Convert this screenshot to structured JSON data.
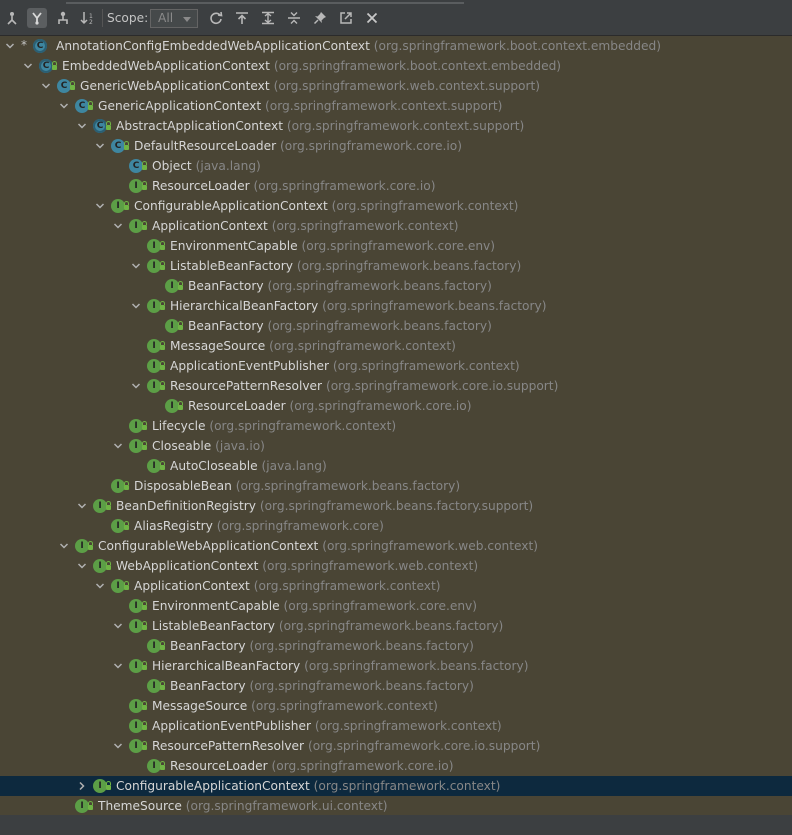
{
  "toolbar": {
    "scope_label": "Scope:",
    "scope_value": "All",
    "buttons": [
      {
        "name": "supertypes-hierarchy-button",
        "icon": "supertypes-icon"
      },
      {
        "name": "class-hierarchy-button",
        "icon": "hierarchy-icon",
        "active": true
      },
      {
        "name": "subtypes-hierarchy-button",
        "icon": "subtypes-icon"
      },
      {
        "name": "sort-alphabetically-button",
        "icon": "sort-alpha-icon"
      },
      {
        "name": "refresh-button",
        "icon": "refresh-icon"
      },
      {
        "name": "base-on-this-class-button",
        "icon": "base-class-icon"
      },
      {
        "name": "expand-all-button",
        "icon": "expand-all-icon"
      },
      {
        "name": "collapse-all-button",
        "icon": "collapse-all-icon"
      },
      {
        "name": "pin-tab-button",
        "icon": "pin-icon"
      },
      {
        "name": "export-button",
        "icon": "export-icon"
      },
      {
        "name": "close-button",
        "icon": "close-icon"
      }
    ]
  },
  "colors": {
    "background": "#4a4535",
    "toolbar": "#3c3f41",
    "selected_row": "#0d293e",
    "class_icon": "#3e86a0",
    "interface_icon": "#5c9e46",
    "package_text": "#878787",
    "name_text": "#d6d6d6"
  },
  "tree": [
    {
      "depth": 0,
      "arrow": "expanded",
      "star": true,
      "icon": "abstract-class",
      "lock": false,
      "name": "AnnotationConfigEmbeddedWebApplicationContext",
      "pkg": "(org.springframework.boot.context.embedded)"
    },
    {
      "depth": 1,
      "arrow": "expanded",
      "icon": "abstract-class",
      "lock": true,
      "name": "EmbeddedWebApplicationContext",
      "pkg": "(org.springframework.boot.context.embedded)"
    },
    {
      "depth": 2,
      "arrow": "expanded",
      "icon": "class",
      "lock": true,
      "name": "GenericWebApplicationContext",
      "pkg": "(org.springframework.web.context.support)"
    },
    {
      "depth": 3,
      "arrow": "expanded",
      "icon": "class",
      "lock": true,
      "name": "GenericApplicationContext",
      "pkg": "(org.springframework.context.support)"
    },
    {
      "depth": 4,
      "arrow": "expanded",
      "icon": "abstract-class",
      "lock": true,
      "name": "AbstractApplicationContext",
      "pkg": "(org.springframework.context.support)"
    },
    {
      "depth": 5,
      "arrow": "expanded",
      "icon": "class",
      "lock": true,
      "name": "DefaultResourceLoader",
      "pkg": "(org.springframework.core.io)"
    },
    {
      "depth": 6,
      "arrow": "none",
      "icon": "class",
      "lock": true,
      "name": "Object",
      "pkg": "(java.lang)"
    },
    {
      "depth": 6,
      "arrow": "none",
      "icon": "interface",
      "lock": true,
      "name": "ResourceLoader",
      "pkg": "(org.springframework.core.io)"
    },
    {
      "depth": 5,
      "arrow": "expanded",
      "icon": "interface",
      "lock": true,
      "name": "ConfigurableApplicationContext",
      "pkg": "(org.springframework.context)"
    },
    {
      "depth": 6,
      "arrow": "expanded",
      "icon": "interface",
      "lock": true,
      "name": "ApplicationContext",
      "pkg": "(org.springframework.context)"
    },
    {
      "depth": 7,
      "arrow": "none",
      "icon": "interface",
      "lock": true,
      "name": "EnvironmentCapable",
      "pkg": "(org.springframework.core.env)"
    },
    {
      "depth": 7,
      "arrow": "expanded",
      "icon": "interface",
      "lock": true,
      "name": "ListableBeanFactory",
      "pkg": "(org.springframework.beans.factory)"
    },
    {
      "depth": 8,
      "arrow": "none",
      "icon": "interface",
      "lock": true,
      "name": "BeanFactory",
      "pkg": "(org.springframework.beans.factory)"
    },
    {
      "depth": 7,
      "arrow": "expanded",
      "icon": "interface",
      "lock": true,
      "name": "HierarchicalBeanFactory",
      "pkg": "(org.springframework.beans.factory)"
    },
    {
      "depth": 8,
      "arrow": "none",
      "icon": "interface",
      "lock": true,
      "name": "BeanFactory",
      "pkg": "(org.springframework.beans.factory)"
    },
    {
      "depth": 7,
      "arrow": "none",
      "icon": "interface",
      "lock": true,
      "name": "MessageSource",
      "pkg": "(org.springframework.context)"
    },
    {
      "depth": 7,
      "arrow": "none",
      "icon": "interface",
      "lock": true,
      "name": "ApplicationEventPublisher",
      "pkg": "(org.springframework.context)"
    },
    {
      "depth": 7,
      "arrow": "expanded",
      "icon": "interface",
      "lock": true,
      "name": "ResourcePatternResolver",
      "pkg": "(org.springframework.core.io.support)"
    },
    {
      "depth": 8,
      "arrow": "none",
      "icon": "interface",
      "lock": true,
      "name": "ResourceLoader",
      "pkg": "(org.springframework.core.io)"
    },
    {
      "depth": 6,
      "arrow": "none",
      "icon": "interface",
      "lock": true,
      "name": "Lifecycle",
      "pkg": "(org.springframework.context)"
    },
    {
      "depth": 6,
      "arrow": "expanded",
      "icon": "interface",
      "lock": true,
      "name": "Closeable",
      "pkg": "(java.io)"
    },
    {
      "depth": 7,
      "arrow": "none",
      "icon": "interface",
      "lock": true,
      "name": "AutoCloseable",
      "pkg": "(java.lang)"
    },
    {
      "depth": 5,
      "arrow": "none",
      "icon": "interface",
      "lock": true,
      "name": "DisposableBean",
      "pkg": "(org.springframework.beans.factory)"
    },
    {
      "depth": 4,
      "arrow": "expanded",
      "icon": "interface",
      "lock": true,
      "name": "BeanDefinitionRegistry",
      "pkg": "(org.springframework.beans.factory.support)"
    },
    {
      "depth": 5,
      "arrow": "none",
      "icon": "interface",
      "lock": true,
      "name": "AliasRegistry",
      "pkg": "(org.springframework.core)"
    },
    {
      "depth": 3,
      "arrow": "expanded",
      "icon": "interface",
      "lock": true,
      "name": "ConfigurableWebApplicationContext",
      "pkg": "(org.springframework.web.context)"
    },
    {
      "depth": 4,
      "arrow": "expanded",
      "icon": "interface",
      "lock": true,
      "name": "WebApplicationContext",
      "pkg": "(org.springframework.web.context)"
    },
    {
      "depth": 5,
      "arrow": "expanded",
      "icon": "interface",
      "lock": true,
      "name": "ApplicationContext",
      "pkg": "(org.springframework.context)"
    },
    {
      "depth": 6,
      "arrow": "none",
      "icon": "interface",
      "lock": true,
      "name": "EnvironmentCapable",
      "pkg": "(org.springframework.core.env)"
    },
    {
      "depth": 6,
      "arrow": "expanded",
      "icon": "interface",
      "lock": true,
      "name": "ListableBeanFactory",
      "pkg": "(org.springframework.beans.factory)"
    },
    {
      "depth": 7,
      "arrow": "none",
      "icon": "interface",
      "lock": true,
      "name": "BeanFactory",
      "pkg": "(org.springframework.beans.factory)"
    },
    {
      "depth": 6,
      "arrow": "expanded",
      "icon": "interface",
      "lock": true,
      "name": "HierarchicalBeanFactory",
      "pkg": "(org.springframework.beans.factory)"
    },
    {
      "depth": 7,
      "arrow": "none",
      "icon": "interface",
      "lock": true,
      "name": "BeanFactory",
      "pkg": "(org.springframework.beans.factory)"
    },
    {
      "depth": 6,
      "arrow": "none",
      "icon": "interface",
      "lock": true,
      "name": "MessageSource",
      "pkg": "(org.springframework.context)"
    },
    {
      "depth": 6,
      "arrow": "none",
      "icon": "interface",
      "lock": true,
      "name": "ApplicationEventPublisher",
      "pkg": "(org.springframework.context)"
    },
    {
      "depth": 6,
      "arrow": "expanded",
      "icon": "interface",
      "lock": true,
      "name": "ResourcePatternResolver",
      "pkg": "(org.springframework.core.io.support)"
    },
    {
      "depth": 7,
      "arrow": "none",
      "icon": "interface",
      "lock": true,
      "name": "ResourceLoader",
      "pkg": "(org.springframework.core.io)"
    },
    {
      "depth": 4,
      "arrow": "collapsed",
      "icon": "interface",
      "lock": true,
      "name": "ConfigurableApplicationContext",
      "pkg": "(org.springframework.context)",
      "selected": true
    },
    {
      "depth": 3,
      "arrow": "none",
      "icon": "interface",
      "lock": true,
      "name": "ThemeSource",
      "pkg": "(org.springframework.ui.context)"
    }
  ]
}
